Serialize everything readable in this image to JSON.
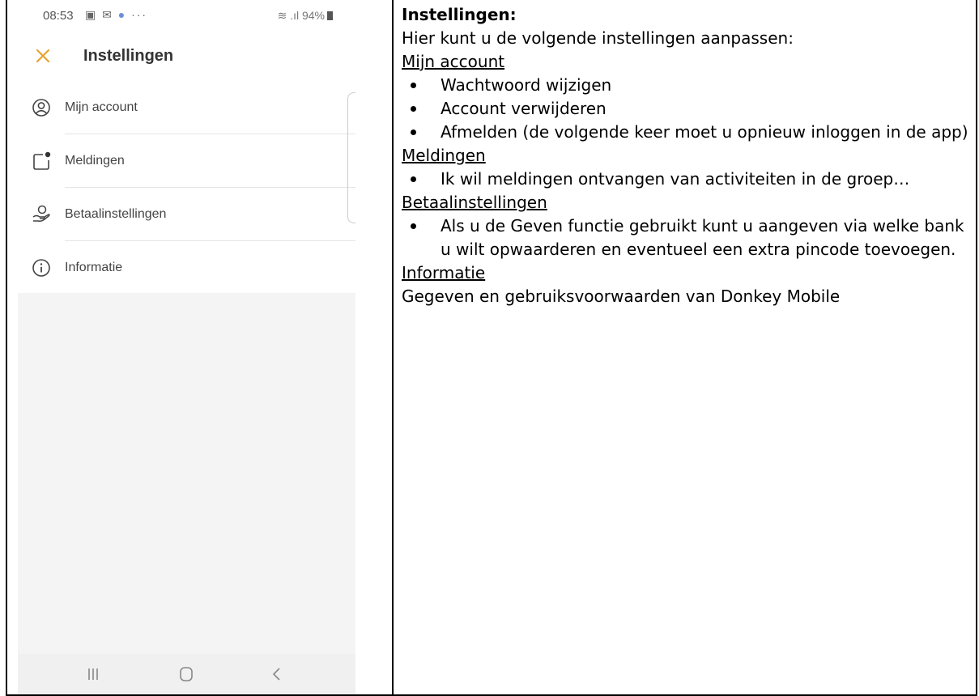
{
  "phone": {
    "status_bar": {
      "time": "08:53",
      "battery": "94%",
      "icons": [
        "gallery-icon",
        "mail-icon",
        "messenger-icon",
        "more-icon",
        "wifi-icon",
        "signal-icon",
        "battery-icon"
      ]
    },
    "header": {
      "title": "Instellingen",
      "close_icon": "close-icon",
      "accent_color": "#e8a230"
    },
    "menu": [
      {
        "label": "Mijn account",
        "icon": "account-icon"
      },
      {
        "label": "Meldingen",
        "icon": "notification-icon"
      },
      {
        "label": "Betaalinstellingen",
        "icon": "payment-hand-icon"
      },
      {
        "label": "Informatie",
        "icon": "info-icon"
      }
    ],
    "nav_bar": [
      "recent-apps-icon",
      "home-icon",
      "back-icon"
    ]
  },
  "document": {
    "title": "Instellingen:",
    "intro": "Hier kunt u de volgende instellingen aanpassen:",
    "sections": [
      {
        "heading": "Mijn account",
        "bullets": [
          "Wachtwoord wijzigen",
          "Account verwijderen",
          "Afmelden (de volgende keer moet u opnieuw inloggen in de app)"
        ]
      },
      {
        "heading": "Meldingen",
        "bullets": [
          "Ik wil meldingen ontvangen van activiteiten in de groep…"
        ]
      },
      {
        "heading": "Betaalinstellingen",
        "bullets": [
          "Als u de Geven functie gebruikt kunt u aangeven via welke bank u wilt opwaarderen en eventueel een extra pincode toevoegen."
        ]
      },
      {
        "heading": "Informatie",
        "text": "Gegeven en gebruiksvoorwaarden van Donkey Mobile"
      }
    ]
  }
}
